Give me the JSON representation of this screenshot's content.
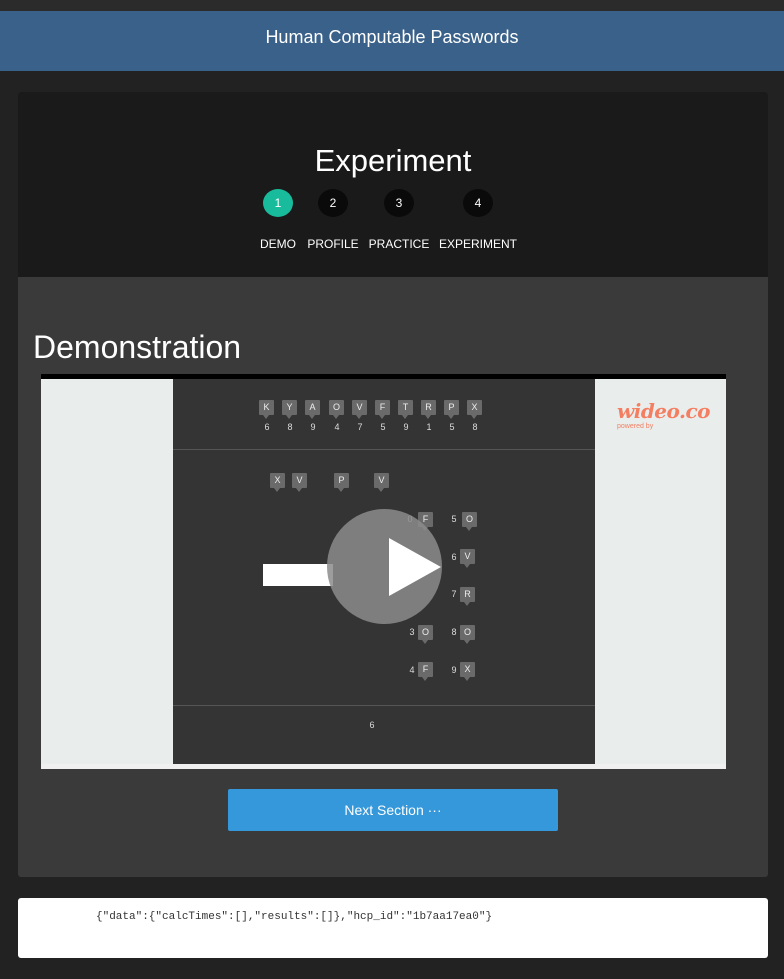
{
  "navbar": {
    "title": "Human Computable Passwords"
  },
  "panel": {
    "title": "Experiment",
    "steps": [
      {
        "number": "1",
        "label": "DEMO",
        "active": true
      },
      {
        "number": "2",
        "label": "PROFILE",
        "active": false
      },
      {
        "number": "3",
        "label": "PRACTICE",
        "active": false
      },
      {
        "number": "4",
        "label": "EXPERIMENT",
        "active": false
      }
    ],
    "section_heading": "Demonstration",
    "next_button": "Next Section ···"
  },
  "video": {
    "top_row": {
      "letters": [
        "K",
        "Y",
        "A",
        "O",
        "V",
        "F",
        "T",
        "R",
        "P",
        "X"
      ],
      "digits": [
        "6",
        "8",
        "9",
        "4",
        "7",
        "5",
        "9",
        "1",
        "5",
        "8"
      ]
    },
    "query_letters": [
      "X",
      "V",
      "P",
      "V"
    ],
    "options": [
      {
        "digit": "0",
        "letter": "F"
      },
      {
        "digit": "5",
        "letter": "O"
      },
      {
        "digit": "6",
        "letter": "V"
      },
      {
        "digit": "7",
        "letter": "R"
      },
      {
        "digit": "3",
        "letter": "O"
      },
      {
        "digit": "8",
        "letter": "O"
      },
      {
        "digit": "4",
        "letter": "F"
      },
      {
        "digit": "9",
        "letter": "X"
      }
    ],
    "bottom_digit": "6",
    "brand": {
      "logo": "wideo.co",
      "tagline": "powered by"
    },
    "play_icon": "play-icon"
  },
  "json_output": "{\"data\":{\"calcTimes\":[],\"results\":[]},\"hcp_id\":\"1b7aa17ea0\"}",
  "colors": {
    "navbar": "#3a6189",
    "active_step": "#18bc9c",
    "button": "#3498db"
  }
}
